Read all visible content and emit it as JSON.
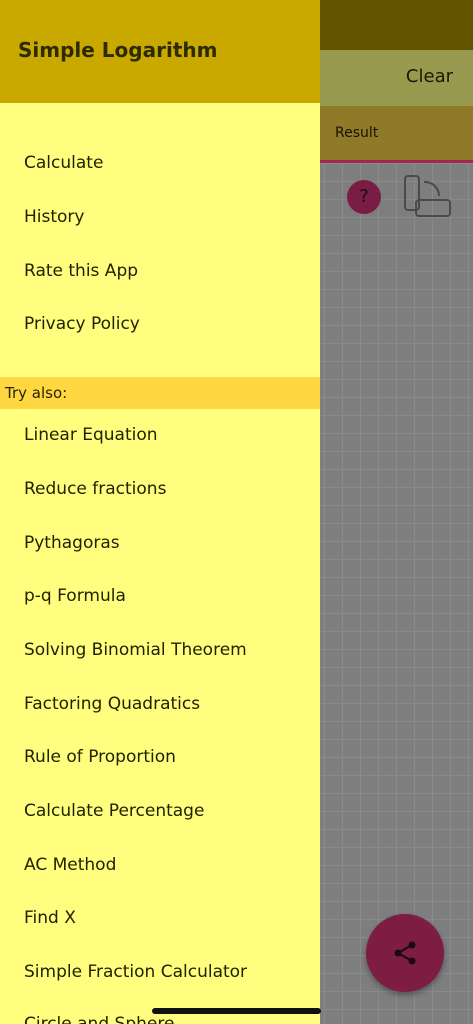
{
  "background_app": {
    "clear_label": "Clear",
    "result_label": "Result",
    "help_icon_glyph": "?"
  },
  "drawer": {
    "title": "Simple Logarithm",
    "menu_items": [
      {
        "label": "Calculate"
      },
      {
        "label": "History"
      },
      {
        "label": "Rate this App"
      },
      {
        "label": "Privacy Policy"
      }
    ],
    "try_also_label": "Try also:",
    "try_also_items": [
      {
        "label": "Linear Equation"
      },
      {
        "label": "Reduce fractions"
      },
      {
        "label": "Pythagoras"
      },
      {
        "label": "p-q Formula"
      },
      {
        "label": "Solving Binomial Theorem"
      },
      {
        "label": "Factoring Quadratics"
      },
      {
        "label": "Rule of Proportion"
      },
      {
        "label": "Calculate Percentage"
      },
      {
        "label": "AC Method"
      },
      {
        "label": "Find X"
      },
      {
        "label": "Simple Fraction Calculator"
      },
      {
        "label": "Circle and Sphere"
      }
    ]
  },
  "colors": {
    "drawer_background": "#fffe7e",
    "drawer_header": "#c9a900",
    "section_band": "#ffd740",
    "accent": "#a02755"
  }
}
